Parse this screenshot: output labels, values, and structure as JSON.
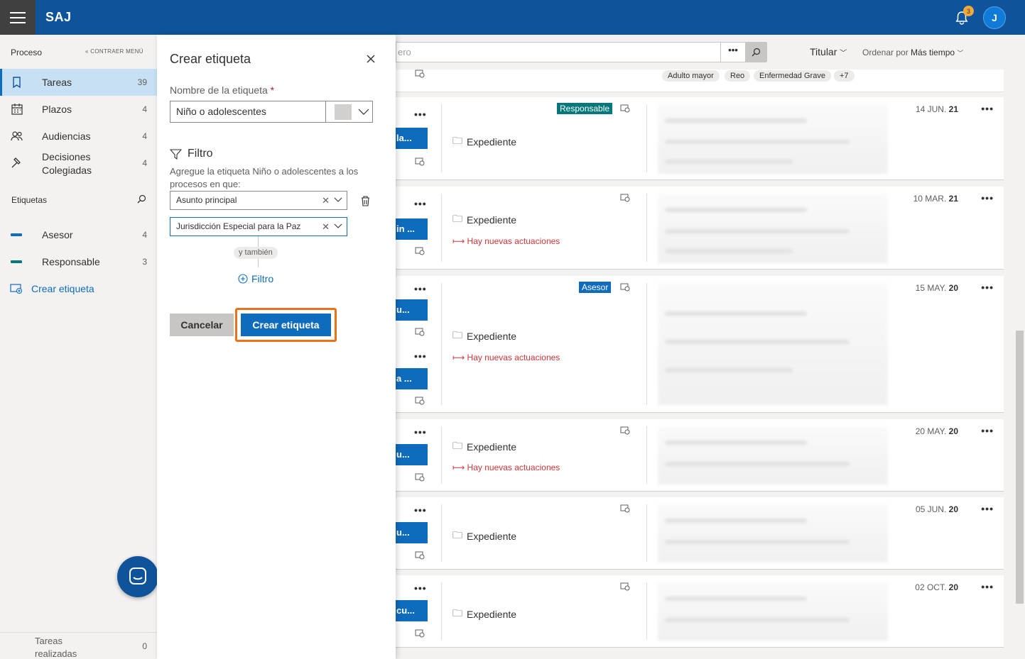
{
  "app": {
    "brand": "SAJ",
    "notifications": "3",
    "user_initial": "J"
  },
  "sidebar": {
    "header": "Proceso",
    "collapse": "CONTRAER MENÚ",
    "items": [
      {
        "label": "Tareas",
        "count": "39"
      },
      {
        "label": "Plazos",
        "count": "4"
      },
      {
        "label": "Audiencias",
        "count": "4"
      },
      {
        "label": "Decisiones Colegiadas",
        "count": "4"
      }
    ],
    "tags_header": "Etiquetas",
    "tags": [
      {
        "label": "Asesor",
        "count": "4",
        "color": "#0f6cbd"
      },
      {
        "label": "Responsable",
        "count": "3",
        "color": "#03787c"
      }
    ],
    "create_tag": "Crear etiqueta",
    "footer": {
      "label": "Tareas realizadas",
      "count": "0"
    }
  },
  "panel": {
    "title": "Crear etiqueta",
    "name_label": "Nombre de la etiqueta",
    "required_mark": "*",
    "name_value": "Niño o adolescentes",
    "filter_title": "Filtro",
    "filter_desc": "Agregue la etiqueta Niño o adolescentes a los procesos en que:",
    "filter1": "Asunto principal",
    "filter2": "Jurisdicción Especial para la Paz",
    "also": "y también",
    "add_filter": "Filtro",
    "cancel": "Cancelar",
    "create": "Crear etiqueta"
  },
  "main": {
    "search_placeholder": "ero",
    "more": "•••",
    "sort_field": "Titular",
    "order_label": "Ordenar por",
    "order_value": "Más tiempo",
    "chips": [
      "Adulto mayor",
      "Reo",
      "Enfermedad Grave",
      "+7"
    ],
    "cards": [
      {
        "tag": "la...",
        "expediente": "Expediente",
        "badge": "Responsable",
        "badge_color": "#03787c",
        "news": "",
        "date_a": "14 JUN.",
        "date_b": "21"
      },
      {
        "tag": "in ...",
        "expediente": "Expediente",
        "badge": "",
        "news": "Hay nuevas actuaciones",
        "date_a": "10 MAR.",
        "date_b": "21"
      },
      {
        "tag": "u...",
        "tag2": "a ...",
        "expediente": "Expediente",
        "badge": "Asesor",
        "badge_color": "#0f6cbd",
        "news": "Hay nuevas actuaciones",
        "date_a": "15 MAY.",
        "date_b": "20"
      },
      {
        "tag": "u...",
        "expediente": "Expediente",
        "badge": "",
        "news": "Hay nuevas actuaciones",
        "date_a": "20 MAY.",
        "date_b": "20"
      },
      {
        "tag": "u...",
        "expediente": "Expediente",
        "badge": "",
        "news": "",
        "date_a": "05 JUN.",
        "date_b": "20"
      },
      {
        "tag": "cu...",
        "expediente": "Expediente",
        "badge": "",
        "news": "",
        "date_a": "02 OCT.",
        "date_b": "20"
      }
    ]
  }
}
